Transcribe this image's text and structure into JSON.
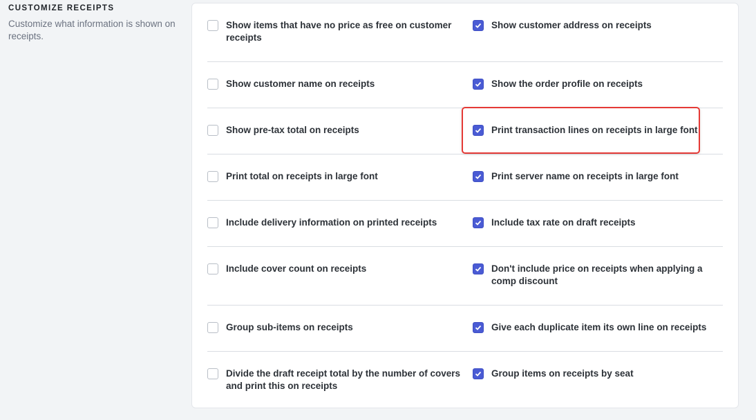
{
  "section": {
    "title": "CUSTOMIZE RECEIPTS",
    "description": "Customize what information is shown on receipts."
  },
  "rows": [
    {
      "left": {
        "label": "Show items that have no price as free on customer receipts",
        "checked": false
      },
      "right": {
        "label": "Show customer address on receipts",
        "checked": true
      }
    },
    {
      "left": {
        "label": "Show customer name on receipts",
        "checked": false
      },
      "right": {
        "label": "Show the order profile on receipts",
        "checked": true
      }
    },
    {
      "left": {
        "label": "Show pre-tax total on receipts",
        "checked": false
      },
      "right": {
        "label": "Print transaction lines on receipts in large font",
        "checked": true
      }
    },
    {
      "left": {
        "label": "Print total on receipts in large font",
        "checked": false
      },
      "right": {
        "label": "Print server name on receipts in large font",
        "checked": true
      }
    },
    {
      "left": {
        "label": "Include delivery information on printed receipts",
        "checked": false
      },
      "right": {
        "label": "Include tax rate on draft receipts",
        "checked": true
      }
    },
    {
      "left": {
        "label": "Include cover count on receipts",
        "checked": false
      },
      "right": {
        "label": "Don't include price on receipts when applying a comp discount",
        "checked": true
      }
    },
    {
      "left": {
        "label": "Group sub-items on receipts",
        "checked": false
      },
      "right": {
        "label": "Give each duplicate item its own line on receipts",
        "checked": true
      }
    },
    {
      "left": {
        "label": "Divide the draft receipt total by the number of covers and print this on receipts",
        "checked": false
      },
      "right": {
        "label": "Group items on receipts by seat",
        "checked": true
      }
    }
  ],
  "colors": {
    "checkbox_checked": "#4a5bd4",
    "highlight_border": "#e53935"
  }
}
